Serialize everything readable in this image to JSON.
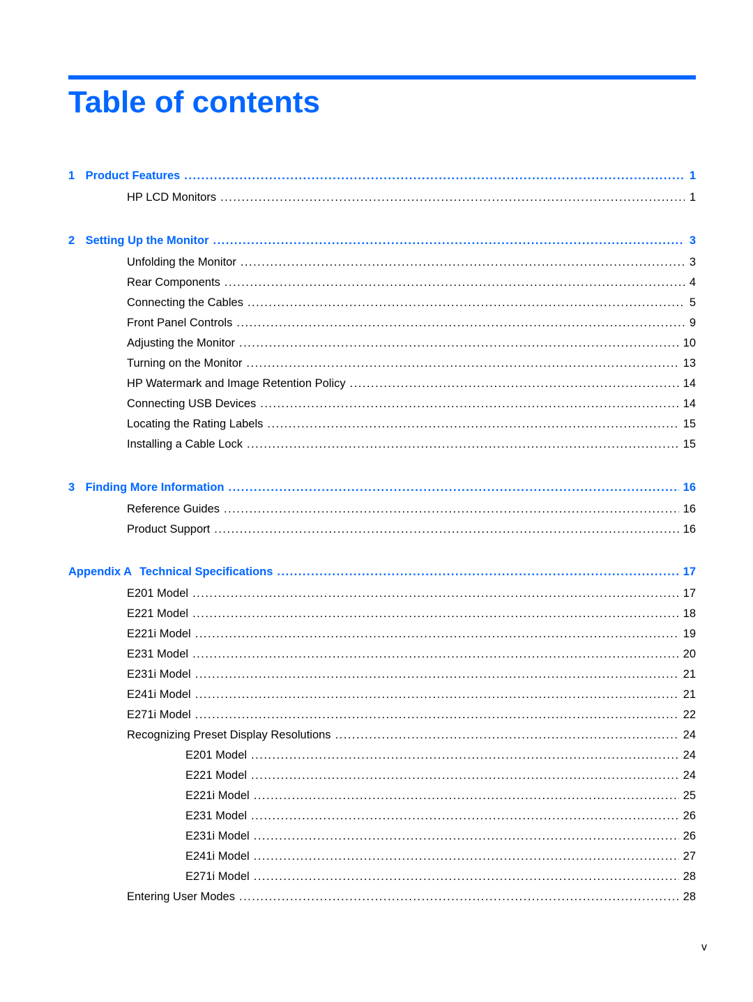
{
  "page": {
    "title": "Table of contents",
    "folio": "v",
    "accent_color": "#0066ff"
  },
  "toc": {
    "chapters": [
      {
        "number": "1",
        "title": "Product Features",
        "page": "1",
        "entries": [
          {
            "title": "HP LCD Monitors",
            "page": "1"
          }
        ]
      },
      {
        "number": "2",
        "title": "Setting Up the Monitor",
        "page": "3",
        "entries": [
          {
            "title": "Unfolding the Monitor",
            "page": "3"
          },
          {
            "title": "Rear Components",
            "page": "4"
          },
          {
            "title": "Connecting the Cables",
            "page": "5"
          },
          {
            "title": "Front Panel Controls",
            "page": "9"
          },
          {
            "title": "Adjusting the Monitor",
            "page": "10"
          },
          {
            "title": "Turning on the Monitor",
            "page": "13"
          },
          {
            "title": "HP Watermark and Image Retention Policy",
            "page": "14"
          },
          {
            "title": "Connecting USB Devices",
            "page": "14"
          },
          {
            "title": "Locating the Rating Labels",
            "page": "15"
          },
          {
            "title": "Installing a Cable Lock",
            "page": "15"
          }
        ]
      },
      {
        "number": "3",
        "title": "Finding More Information",
        "page": "16",
        "entries": [
          {
            "title": "Reference Guides",
            "page": "16"
          },
          {
            "title": "Product Support",
            "page": "16"
          }
        ]
      },
      {
        "number": "Appendix A",
        "title": "Technical Specifications",
        "page": "17",
        "entries": [
          {
            "title": "E201 Model",
            "page": "17"
          },
          {
            "title": "E221 Model",
            "page": "18"
          },
          {
            "title": "E221i Model",
            "page": "19"
          },
          {
            "title": "E231 Model",
            "page": "20"
          },
          {
            "title": "E231i Model",
            "page": "21"
          },
          {
            "title": "E241i Model",
            "page": "21"
          },
          {
            "title": "E271i Model",
            "page": "22"
          },
          {
            "title": "Recognizing Preset Display Resolutions",
            "page": "24",
            "subentries": [
              {
                "title": "E201 Model",
                "page": "24"
              },
              {
                "title": "E221 Model",
                "page": "24"
              },
              {
                "title": "E221i Model",
                "page": "25"
              },
              {
                "title": "E231 Model",
                "page": "26"
              },
              {
                "title": "E231i Model",
                "page": "26"
              },
              {
                "title": "E241i Model",
                "page": "27"
              },
              {
                "title": "E271i Model",
                "page": "28"
              }
            ]
          },
          {
            "title": "Entering User Modes",
            "page": "28"
          }
        ]
      }
    ]
  }
}
